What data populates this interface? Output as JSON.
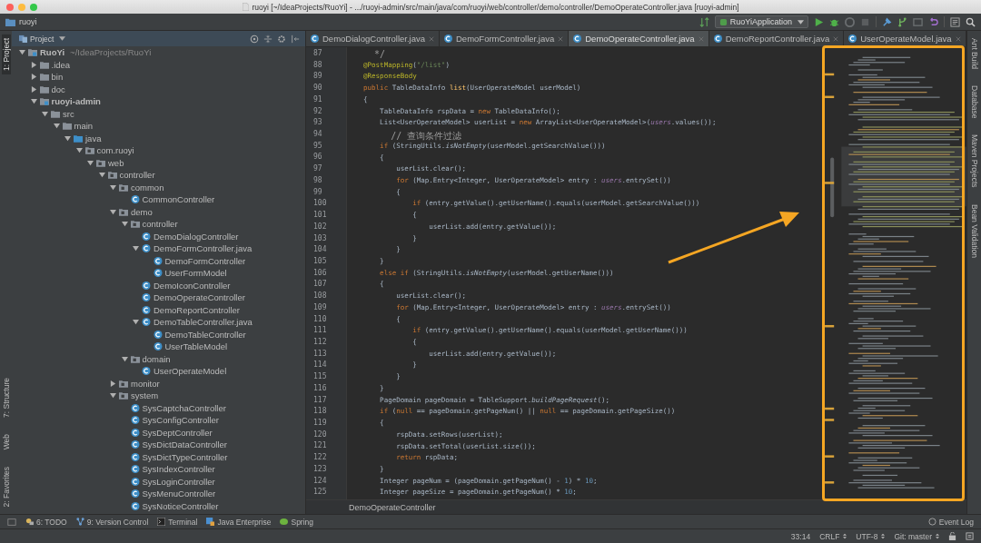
{
  "window": {
    "title": "ruoyi [~/IdeaProjects/RuoYi] - .../ruoyi-admin/src/main/java/com/ruoyi/web/controller/demo/controller/DemoOperateController.java [ruoyi-admin]"
  },
  "toolbar": {
    "breadcrumb": "ruoyi",
    "run_config": "RuoYiApplication"
  },
  "left_tool_windows": [
    {
      "label": "1: Project",
      "selected": true
    },
    {
      "label": "7: Structure",
      "selected": false
    },
    {
      "label": "Web",
      "selected": false
    },
    {
      "label": "2: Favorites",
      "selected": false
    }
  ],
  "right_tool_windows": [
    {
      "label": "Ant Build"
    },
    {
      "label": "Database"
    },
    {
      "label": "Maven Projects"
    },
    {
      "label": "Bean Validation"
    }
  ],
  "project_panel": {
    "title": "Project"
  },
  "project_tree": [
    {
      "label": "RuoYi",
      "path": "~/IdeaProjects/RuoYi",
      "kind": "module",
      "expanded": true,
      "children": [
        {
          "label": ".idea",
          "kind": "folder",
          "expanded": false
        },
        {
          "label": "bin",
          "kind": "folder",
          "expanded": false
        },
        {
          "label": "doc",
          "kind": "folder",
          "expanded": false
        },
        {
          "label": "ruoyi-admin",
          "kind": "module",
          "expanded": true,
          "children": [
            {
              "label": "src",
              "kind": "folder",
              "expanded": true,
              "children": [
                {
                  "label": "main",
                  "kind": "folder",
                  "expanded": true,
                  "children": [
                    {
                      "label": "java",
                      "kind": "source",
                      "expanded": true,
                      "children": [
                        {
                          "label": "com.ruoyi",
                          "kind": "package",
                          "expanded": true,
                          "children": [
                            {
                              "label": "web",
                              "kind": "package",
                              "expanded": true,
                              "children": [
                                {
                                  "label": "controller",
                                  "kind": "package",
                                  "expanded": true,
                                  "children": [
                                    {
                                      "label": "common",
                                      "kind": "package",
                                      "expanded": true,
                                      "children": [
                                        {
                                          "label": "CommonController",
                                          "kind": "class"
                                        }
                                      ]
                                    },
                                    {
                                      "label": "demo",
                                      "kind": "package",
                                      "expanded": true,
                                      "children": [
                                        {
                                          "label": "controller",
                                          "kind": "package",
                                          "expanded": true,
                                          "children": [
                                            {
                                              "label": "DemoDialogController",
                                              "kind": "class"
                                            },
                                            {
                                              "label": "DemoFormController.java",
                                              "kind": "class",
                                              "expanded": true,
                                              "children": [
                                                {
                                                  "label": "DemoFormController",
                                                  "kind": "class"
                                                },
                                                {
                                                  "label": "UserFormModel",
                                                  "kind": "class"
                                                }
                                              ]
                                            },
                                            {
                                              "label": "DemoIconController",
                                              "kind": "class"
                                            },
                                            {
                                              "label": "DemoOperateController",
                                              "kind": "class"
                                            },
                                            {
                                              "label": "DemoReportController",
                                              "kind": "class"
                                            },
                                            {
                                              "label": "DemoTableController.java",
                                              "kind": "class",
                                              "expanded": true,
                                              "children": [
                                                {
                                                  "label": "DemoTableController",
                                                  "kind": "class"
                                                },
                                                {
                                                  "label": "UserTableModel",
                                                  "kind": "class"
                                                }
                                              ]
                                            }
                                          ]
                                        },
                                        {
                                          "label": "domain",
                                          "kind": "package",
                                          "expanded": true,
                                          "children": [
                                            {
                                              "label": "UserOperateModel",
                                              "kind": "class"
                                            }
                                          ]
                                        }
                                      ]
                                    },
                                    {
                                      "label": "monitor",
                                      "kind": "package",
                                      "expanded": false
                                    },
                                    {
                                      "label": "system",
                                      "kind": "package",
                                      "expanded": true,
                                      "children": [
                                        {
                                          "label": "SysCaptchaController",
                                          "kind": "class"
                                        },
                                        {
                                          "label": "SysConfigController",
                                          "kind": "class"
                                        },
                                        {
                                          "label": "SysDeptController",
                                          "kind": "class"
                                        },
                                        {
                                          "label": "SysDictDataController",
                                          "kind": "class"
                                        },
                                        {
                                          "label": "SysDictTypeController",
                                          "kind": "class"
                                        },
                                        {
                                          "label": "SysIndexController",
                                          "kind": "class"
                                        },
                                        {
                                          "label": "SysLoginController",
                                          "kind": "class"
                                        },
                                        {
                                          "label": "SysMenuController",
                                          "kind": "class"
                                        },
                                        {
                                          "label": "SysNoticeController",
                                          "kind": "class"
                                        }
                                      ]
                                    }
                                  ]
                                }
                              ]
                            }
                          ]
                        }
                      ]
                    }
                  ]
                }
              ]
            }
          ]
        }
      ]
    }
  ],
  "tabs": [
    {
      "label": "DemoDialogController.java",
      "selected": false
    },
    {
      "label": "DemoFormController.java",
      "selected": false
    },
    {
      "label": "DemoOperateController.java",
      "selected": true
    },
    {
      "label": "DemoReportController.java",
      "selected": false
    },
    {
      "label": "UserOperateModel.java",
      "selected": false
    }
  ],
  "code_lines": [
    {
      "number": "87",
      "segments": [
        {
          "kind": "comment",
          "text": "     */"
        }
      ]
    },
    {
      "number": "88",
      "segments": [
        {
          "kind": "ann",
          "text": "    @PostMapping"
        },
        {
          "kind": "plain",
          "text": "("
        },
        {
          "kind": "str",
          "text": "\"/list\""
        },
        {
          "kind": "plain",
          "text": ")"
        }
      ]
    },
    {
      "number": "89",
      "segments": [
        {
          "kind": "ann",
          "text": "    @ResponseBody"
        }
      ]
    },
    {
      "number": "90",
      "segments": [
        {
          "kind": "kw",
          "text": "    public"
        },
        {
          "kind": "plain",
          "text": " TableDataInfo "
        },
        {
          "kind": "fn",
          "text": "list"
        },
        {
          "kind": "plain",
          "text": "(UserOperateModel userModel)"
        }
      ]
    },
    {
      "number": "91",
      "segments": [
        {
          "kind": "plain",
          "text": "    {"
        }
      ]
    },
    {
      "number": "92",
      "segments": [
        {
          "kind": "plain",
          "text": "        TableDataInfo rspData = "
        },
        {
          "kind": "kw",
          "text": "new"
        },
        {
          "kind": "plain",
          "text": " TableDataInfo();"
        }
      ]
    },
    {
      "number": "93",
      "segments": [
        {
          "kind": "plain",
          "text": "        List<UserOperateModel> userList = "
        },
        {
          "kind": "kw",
          "text": "new"
        },
        {
          "kind": "plain",
          "text": " ArrayList<UserOperateModel>("
        },
        {
          "kind": "field",
          "text": "users"
        },
        {
          "kind": "plain",
          "text": ".values());"
        }
      ]
    },
    {
      "number": "94",
      "segments": [
        {
          "kind": "comment",
          "text": "        // 查询条件过滤"
        }
      ]
    },
    {
      "number": "95",
      "segments": [
        {
          "kind": "kw",
          "text": "        if"
        },
        {
          "kind": "plain",
          "text": " (StringUtils."
        },
        {
          "kind": "italic",
          "text": "isNotEmpty"
        },
        {
          "kind": "plain",
          "text": "(userModel.getSearchValue()))"
        }
      ]
    },
    {
      "number": "96",
      "segments": [
        {
          "kind": "plain",
          "text": "        {"
        }
      ]
    },
    {
      "number": "97",
      "segments": [
        {
          "kind": "plain",
          "text": "            userList.clear();"
        }
      ]
    },
    {
      "number": "98",
      "segments": [
        {
          "kind": "kw",
          "text": "            for"
        },
        {
          "kind": "plain",
          "text": " (Map.Entry<Integer, UserOperateModel> entry : "
        },
        {
          "kind": "field",
          "text": "users"
        },
        {
          "kind": "plain",
          "text": ".entrySet())"
        }
      ]
    },
    {
      "number": "99",
      "segments": [
        {
          "kind": "plain",
          "text": "            {"
        }
      ]
    },
    {
      "number": "100",
      "segments": [
        {
          "kind": "kw",
          "text": "                if"
        },
        {
          "kind": "plain",
          "text": " (entry.getValue().getUserName().equals(userModel.getSearchValue()))"
        }
      ]
    },
    {
      "number": "101",
      "segments": [
        {
          "kind": "plain",
          "text": "                {"
        }
      ]
    },
    {
      "number": "102",
      "segments": [
        {
          "kind": "plain",
          "text": "                    userList.add(entry.getValue());"
        }
      ]
    },
    {
      "number": "103",
      "segments": [
        {
          "kind": "plain",
          "text": "                }"
        }
      ]
    },
    {
      "number": "104",
      "segments": [
        {
          "kind": "plain",
          "text": "            }"
        }
      ]
    },
    {
      "number": "105",
      "segments": [
        {
          "kind": "plain",
          "text": "        }"
        }
      ]
    },
    {
      "number": "106",
      "segments": [
        {
          "kind": "kw",
          "text": "        else if"
        },
        {
          "kind": "plain",
          "text": " (StringUtils."
        },
        {
          "kind": "italic",
          "text": "isNotEmpty"
        },
        {
          "kind": "plain",
          "text": "(userModel.getUserName()))"
        }
      ]
    },
    {
      "number": "107",
      "segments": [
        {
          "kind": "plain",
          "text": "        {"
        }
      ]
    },
    {
      "number": "108",
      "segments": [
        {
          "kind": "plain",
          "text": "            userList.clear();"
        }
      ]
    },
    {
      "number": "109",
      "segments": [
        {
          "kind": "kw",
          "text": "            for"
        },
        {
          "kind": "plain",
          "text": " (Map.Entry<Integer, UserOperateModel> entry : "
        },
        {
          "kind": "field",
          "text": "users"
        },
        {
          "kind": "plain",
          "text": ".entrySet())"
        }
      ]
    },
    {
      "number": "110",
      "segments": [
        {
          "kind": "plain",
          "text": "            {"
        }
      ]
    },
    {
      "number": "111",
      "segments": [
        {
          "kind": "kw",
          "text": "                if"
        },
        {
          "kind": "plain",
          "text": " (entry.getValue().getUserName().equals(userModel.getUserName()))"
        }
      ]
    },
    {
      "number": "112",
      "segments": [
        {
          "kind": "plain",
          "text": "                {"
        }
      ]
    },
    {
      "number": "113",
      "segments": [
        {
          "kind": "plain",
          "text": "                    userList.add(entry.getValue());"
        }
      ]
    },
    {
      "number": "114",
      "segments": [
        {
          "kind": "plain",
          "text": "                }"
        }
      ]
    },
    {
      "number": "115",
      "segments": [
        {
          "kind": "plain",
          "text": "            }"
        }
      ]
    },
    {
      "number": "116",
      "segments": [
        {
          "kind": "plain",
          "text": "        }"
        }
      ]
    },
    {
      "number": "117",
      "segments": [
        {
          "kind": "plain",
          "text": "        PageDomain pageDomain = TableSupport."
        },
        {
          "kind": "italic",
          "text": "buildPageRequest"
        },
        {
          "kind": "plain",
          "text": "();"
        }
      ]
    },
    {
      "number": "118",
      "segments": [
        {
          "kind": "kw",
          "text": "        if"
        },
        {
          "kind": "plain",
          "text": " ("
        },
        {
          "kind": "kw",
          "text": "null"
        },
        {
          "kind": "plain",
          "text": " == pageDomain.getPageNum() || "
        },
        {
          "kind": "kw",
          "text": "null"
        },
        {
          "kind": "plain",
          "text": " == pageDomain.getPageSize())"
        }
      ]
    },
    {
      "number": "119",
      "segments": [
        {
          "kind": "plain",
          "text": "        {"
        }
      ]
    },
    {
      "number": "120",
      "segments": [
        {
          "kind": "plain",
          "text": "            rspData.setRows(userList);"
        }
      ]
    },
    {
      "number": "121",
      "segments": [
        {
          "kind": "plain",
          "text": "            rspData.setTotal(userList.size());"
        }
      ]
    },
    {
      "number": "122",
      "segments": [
        {
          "kind": "kw",
          "text": "            return"
        },
        {
          "kind": "plain",
          "text": " rspData;"
        }
      ]
    },
    {
      "number": "123",
      "segments": [
        {
          "kind": "plain",
          "text": "        }"
        }
      ]
    },
    {
      "number": "124",
      "segments": [
        {
          "kind": "plain",
          "text": "        Integer pageNum = (pageDomain.getPageNum() - "
        },
        {
          "kind": "num",
          "text": "1"
        },
        {
          "kind": "plain",
          "text": ") * "
        },
        {
          "kind": "num",
          "text": "10"
        },
        {
          "kind": "plain",
          "text": ";"
        }
      ]
    },
    {
      "number": "125",
      "segments": [
        {
          "kind": "plain",
          "text": "        Integer pageSize = pageDomain.getPageNum() * "
        },
        {
          "kind": "num",
          "text": "10"
        },
        {
          "kind": "plain",
          "text": ";"
        }
      ]
    }
  ],
  "editor_breadcrumb": "DemoOperateController",
  "bottom_tools": [
    {
      "label": "6: TODO",
      "kind": "todo"
    },
    {
      "label": "9: Version Control",
      "kind": "vcs"
    },
    {
      "label": "Terminal",
      "kind": "terminal"
    },
    {
      "label": "Java Enterprise",
      "kind": "javaee"
    },
    {
      "label": "Spring",
      "kind": "spring"
    }
  ],
  "event_log": "Event Log",
  "status_bar": {
    "position": "33:14",
    "line_separator": "CRLF",
    "encoding": "UTF-8",
    "vcs_branch": "Git: master"
  }
}
